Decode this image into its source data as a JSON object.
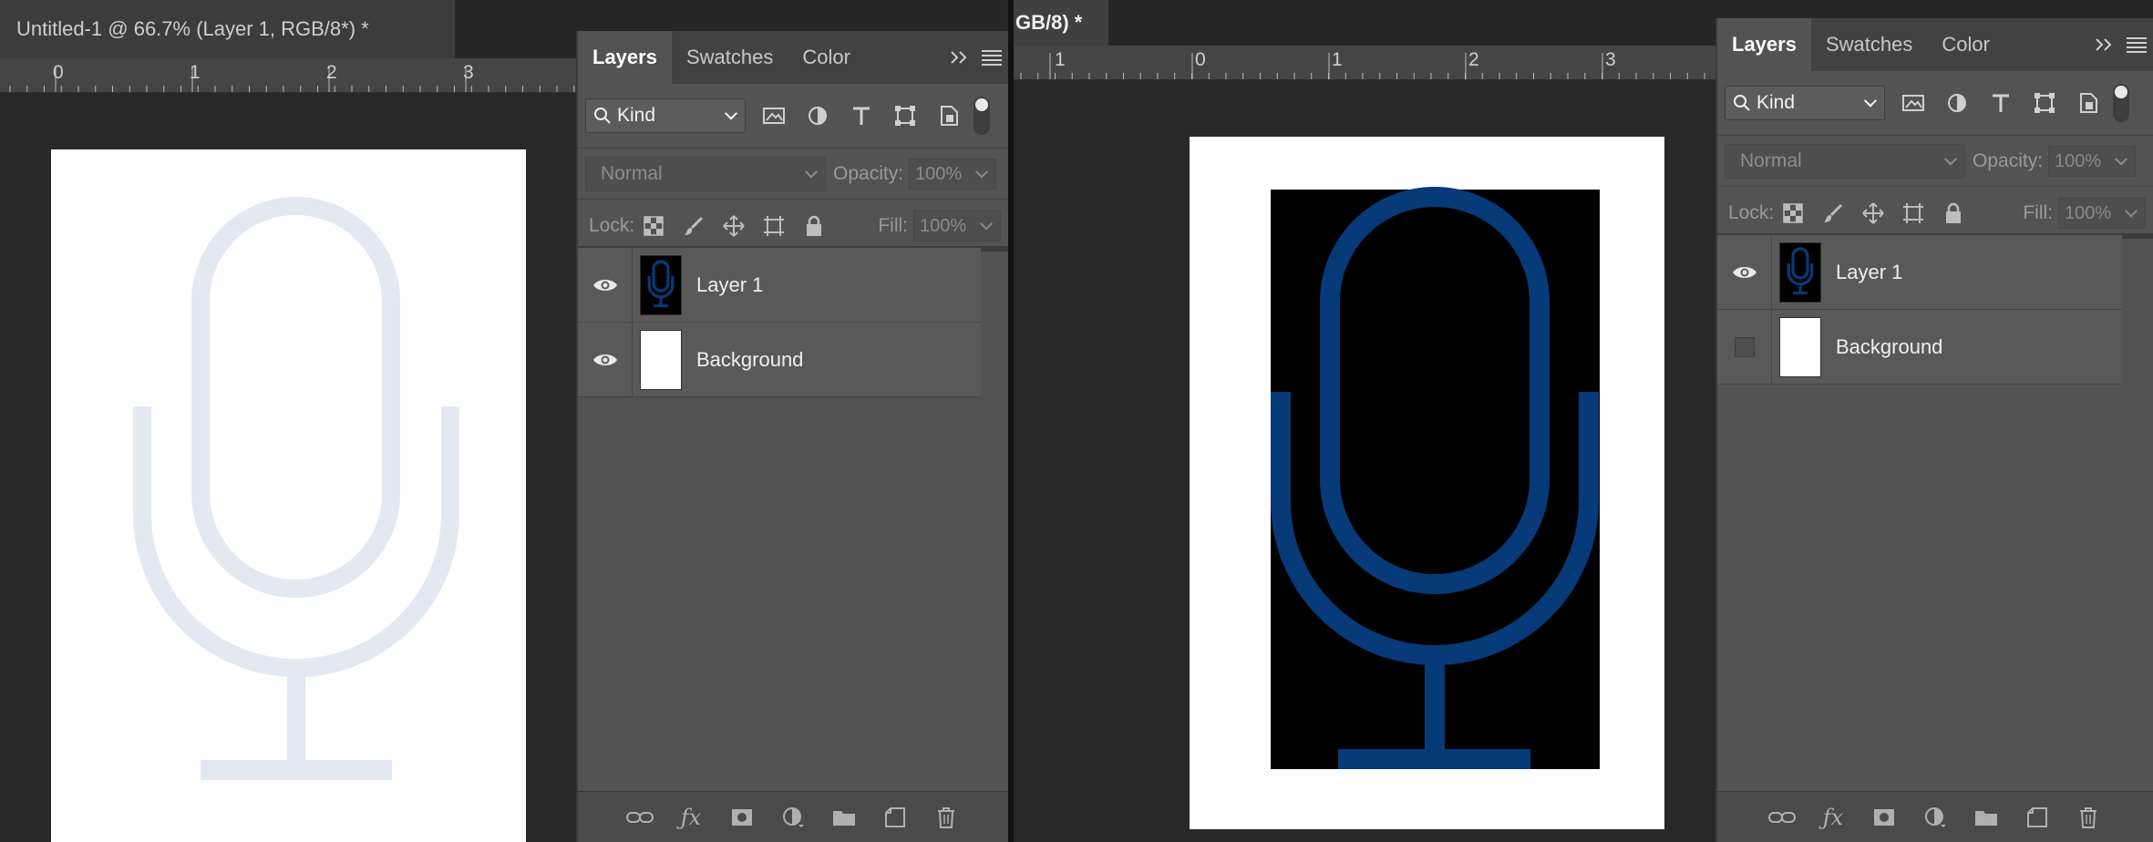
{
  "left": {
    "document_tab": {
      "title": "Untitled-1 @ 66.7% (Layer 1, RGB/8*) *"
    },
    "ruler_numbers": [
      "0",
      "1",
      "2",
      "3"
    ],
    "panel": {
      "tabs": [
        "Layers",
        "Swatches",
        "Color"
      ],
      "filter": {
        "label": "Kind"
      },
      "blend_mode": "Normal",
      "opacity_label": "Opacity:",
      "opacity_value": "100%",
      "lock_label": "Lock:",
      "fill_label": "Fill:",
      "fill_value": "100%",
      "layers": [
        {
          "name": "Layer 1",
          "visible": true
        },
        {
          "name": "Background",
          "visible": true
        }
      ]
    }
  },
  "right": {
    "document_tab": {
      "title": "GB/8) *"
    },
    "ruler_numbers": [
      "1",
      "0",
      "1",
      "2",
      "3"
    ],
    "panel": {
      "tabs": [
        "Layers",
        "Swatches",
        "Color"
      ],
      "filter": {
        "label": "Kind"
      },
      "blend_mode": "Normal",
      "opacity_label": "Opacity:",
      "opacity_value": "100%",
      "lock_label": "Lock:",
      "fill_label": "Fill:",
      "fill_value": "100%",
      "layers": [
        {
          "name": "Layer 1",
          "visible": true
        },
        {
          "name": "Background",
          "visible": false
        }
      ]
    }
  },
  "colors": {
    "mic_faint": "#e4e9f1",
    "mic_blue": "#063a78",
    "panel_bg": "#535353"
  },
  "icons": {
    "filter": [
      "search-icon",
      "image-filter-icon",
      "adjustment-filter-icon",
      "type-filter-icon",
      "shape-filter-icon",
      "smart-object-filter-icon"
    ],
    "lock": [
      "lock-transparent-icon",
      "lock-paint-icon",
      "lock-move-icon",
      "lock-artboard-icon",
      "lock-all-icon"
    ],
    "footer": [
      "link-layers-icon",
      "fx-icon",
      "add-mask-icon",
      "new-adjustment-icon",
      "new-group-icon",
      "new-layer-icon",
      "delete-icon"
    ]
  }
}
